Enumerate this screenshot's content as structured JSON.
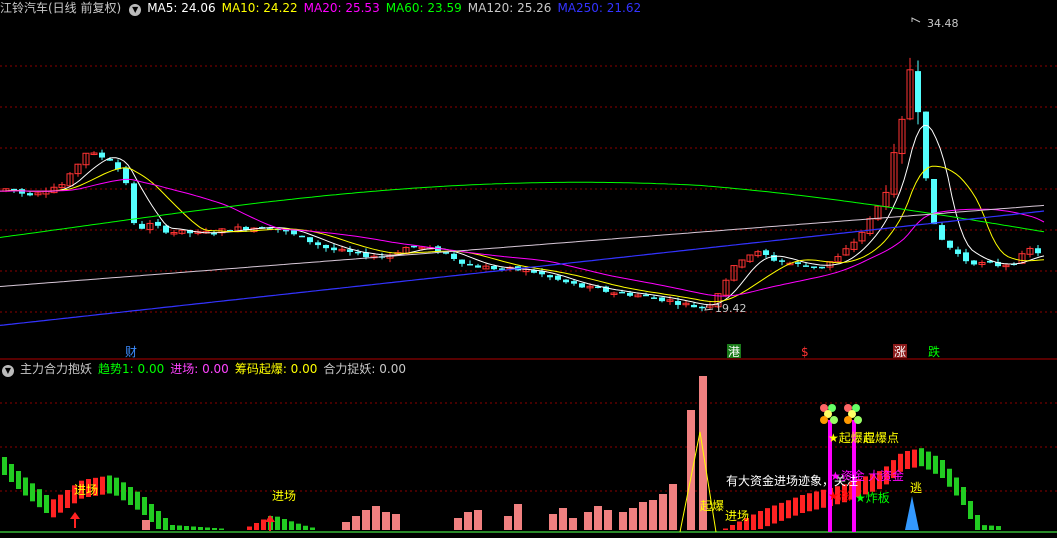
{
  "main_panel": {
    "title": "江铃汽车(日线 前复权)",
    "ma": [
      {
        "label": "MA5: 24.06",
        "color": "#ffffff"
      },
      {
        "label": "MA10: 24.22",
        "color": "#ffff00"
      },
      {
        "label": "MA20: 25.53",
        "color": "#ff00ff"
      },
      {
        "label": "MA60: 23.59",
        "color": "#00ff00"
      },
      {
        "label": "MA120: 25.26",
        "color": "#c8c8c8"
      },
      {
        "label": "MA250: 21.62",
        "color": "#3333ff"
      }
    ],
    "high_label": "34.48",
    "low_label": "19.42",
    "event_markers": [
      {
        "text": "财",
        "color": "#3c8cff",
        "bg": "#000000"
      },
      {
        "text": "港",
        "color": "#ffffff",
        "bg": "#1a7a1a"
      },
      {
        "text": "$",
        "color": "#ff3333",
        "bg": "#000000"
      },
      {
        "text": "涨",
        "color": "#ffffff",
        "bg": "#8a1a1a"
      },
      {
        "text": "跌",
        "color": "#00ff00",
        "bg": "#000000"
      }
    ]
  },
  "indicator_panel": {
    "title": "主力合力抱妖",
    "values": [
      {
        "label": "趋势1: 0.00",
        "color": "#00ff00"
      },
      {
        "label": "进场: 0.00",
        "color": "#ff44ff"
      },
      {
        "label": "筹码起爆: 0.00",
        "color": "#ffff00"
      },
      {
        "label": "合力捉妖: 0.00",
        "color": "#c8c8c8"
      }
    ],
    "annotations": [
      {
        "text": "进场",
        "color": "#ffff00"
      },
      {
        "text": "进场",
        "color": "#ffff00"
      },
      {
        "text": "起爆",
        "color": "#ffff00"
      },
      {
        "text": "进场",
        "color": "#ffff00"
      },
      {
        "text": "有大资金进场迹象，关注",
        "color": "#ffffff"
      },
      {
        "text": "★起爆点",
        "color": "#ffff00"
      },
      {
        "text": "起爆点",
        "color": "#ffff00"
      },
      {
        "text": "★资金",
        "color": "#ff00ff"
      },
      {
        "text": "大资金",
        "color": "#ff00ff"
      },
      {
        "text": "★涨",
        "color": "#ff0000"
      },
      {
        "text": "★炸板",
        "color": "#00ff00"
      },
      {
        "text": "逃",
        "color": "#ffff00"
      }
    ]
  },
  "chart_data": {
    "type": "candlestick",
    "price_range": [
      18.0,
      36.0
    ],
    "high": 34.48,
    "low": 19.42,
    "ma_last": {
      "MA5": 24.06,
      "MA10": 24.22,
      "MA20": 25.53,
      "MA60": 23.59,
      "MA120": 25.26,
      "MA250": 21.62
    }
  },
  "colors": {
    "up": "#ff3333",
    "down": "#54ffff",
    "grid": "#8b0000",
    "background": "#000000"
  }
}
